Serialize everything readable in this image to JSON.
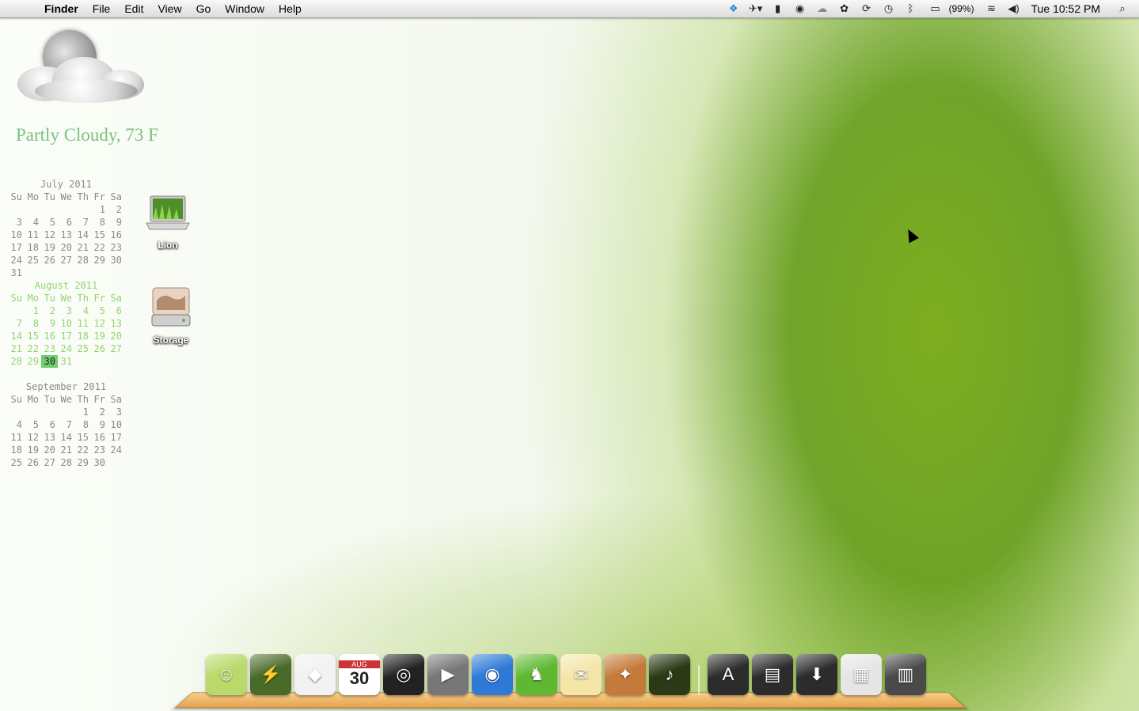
{
  "menubar": {
    "apple_icon": "apple-logo-icon",
    "app_name": "Finder",
    "menus": [
      "File",
      "Edit",
      "View",
      "Go",
      "Window",
      "Help"
    ],
    "battery_percent": "(99%)",
    "clock": "Tue 10:52 PM",
    "tray_icons": [
      "dropbox-icon",
      "growl-icon",
      "readability-icon",
      "alfred-icon",
      "weather-cloud-icon",
      "paw-icon",
      "sync-icon",
      "time-machine-icon",
      "bluetooth-icon",
      "battery-icon",
      "wifi-icon",
      "volume-icon",
      "spotlight-search-icon"
    ]
  },
  "weather": {
    "condition": "Partly Cloudy, 73 F"
  },
  "calendars": [
    {
      "title": "July 2011",
      "weekdays": [
        "Su",
        "Mo",
        "Tu",
        "We",
        "Th",
        "Fr",
        "Sa"
      ],
      "weeks": [
        [
          "",
          "",
          "",
          "",
          "",
          "1",
          "2"
        ],
        [
          "3",
          "4",
          "5",
          "6",
          "7",
          "8",
          "9"
        ],
        [
          "10",
          "11",
          "12",
          "13",
          "14",
          "15",
          "16"
        ],
        [
          "17",
          "18",
          "19",
          "20",
          "21",
          "22",
          "23"
        ],
        [
          "24",
          "25",
          "26",
          "27",
          "28",
          "29",
          "30"
        ],
        [
          "31",
          "",
          "",
          "",
          "",
          "",
          ""
        ]
      ]
    },
    {
      "title": "August 2011",
      "weekdays": [
        "Su",
        "Mo",
        "Tu",
        "We",
        "Th",
        "Fr",
        "Sa"
      ],
      "weeks": [
        [
          "",
          "1",
          "2",
          "3",
          "4",
          "5",
          "6"
        ],
        [
          "7",
          "8",
          "9",
          "10",
          "11",
          "12",
          "13"
        ],
        [
          "14",
          "15",
          "16",
          "17",
          "18",
          "19",
          "20"
        ],
        [
          "21",
          "22",
          "23",
          "24",
          "25",
          "26",
          "27"
        ],
        [
          "28",
          "29",
          "30",
          "31",
          "",
          "",
          ""
        ]
      ],
      "today": "30"
    },
    {
      "title": "September 2011",
      "weekdays": [
        "Su",
        "Mo",
        "Tu",
        "We",
        "Th",
        "Fr",
        "Sa"
      ],
      "weeks": [
        [
          "",
          "",
          "",
          "",
          "1",
          "2",
          "3"
        ],
        [
          "4",
          "5",
          "6",
          "7",
          "8",
          "9",
          "10"
        ],
        [
          "11",
          "12",
          "13",
          "14",
          "15",
          "16",
          "17"
        ],
        [
          "18",
          "19",
          "20",
          "21",
          "22",
          "23",
          "24"
        ],
        [
          "25",
          "26",
          "27",
          "28",
          "29",
          "30",
          ""
        ]
      ]
    }
  ],
  "desktop_icons": [
    {
      "label": "Lion",
      "icon": "laptop-drive-icon"
    },
    {
      "label": "Storage",
      "icon": "hard-drive-icon"
    }
  ],
  "dock": {
    "items": [
      {
        "name": "finder",
        "icon": "finder-icon",
        "color": "#b9d96a"
      },
      {
        "name": "activity",
        "icon": "green-monitor-icon",
        "color": "#4a6a2a"
      },
      {
        "name": "box",
        "icon": "white-box-icon",
        "color": "#f2f2f2"
      },
      {
        "name": "ical",
        "icon": "calendar-icon",
        "color": "#ffffff",
        "badge_month": "AUG",
        "badge_day": "30"
      },
      {
        "name": "ipod",
        "icon": "ipod-icon",
        "color": "#222222"
      },
      {
        "name": "quicktime",
        "icon": "play-button-icon",
        "color": "#777777"
      },
      {
        "name": "firefox",
        "icon": "firefox-icon",
        "color": "#2f7ad6"
      },
      {
        "name": "evernote",
        "icon": "evernote-elephant-icon",
        "color": "#5fb832"
      },
      {
        "name": "mail",
        "icon": "mail-envelope-icon",
        "color": "#f5e6a8"
      },
      {
        "name": "stamp",
        "icon": "stamp-icon",
        "color": "#c47a3a"
      },
      {
        "name": "music-cube",
        "icon": "music-cube-icon",
        "color": "#2b3a14"
      },
      {
        "name": "applications",
        "icon": "applications-folder-icon",
        "color": "#2c2c2c"
      },
      {
        "name": "documents",
        "icon": "documents-folder-icon",
        "color": "#2c2c2c"
      },
      {
        "name": "downloads",
        "icon": "downloads-folder-icon",
        "color": "#2c2c2c"
      },
      {
        "name": "web-browser",
        "icon": "webpage-icon",
        "color": "#e6e6e6"
      },
      {
        "name": "trash",
        "icon": "trash-icon",
        "color": "#4a4a4a"
      }
    ]
  }
}
